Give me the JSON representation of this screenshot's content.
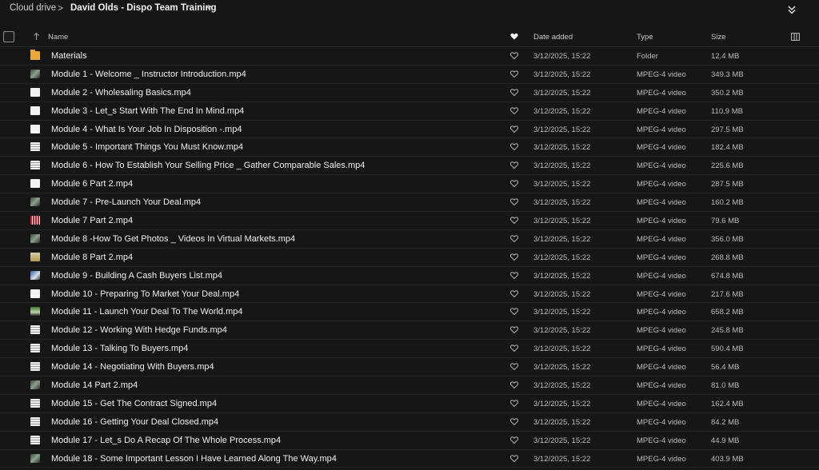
{
  "breadcrumb": {
    "root": "Cloud drive",
    "separator": ">",
    "current": "David Olds - Dispo Team Training"
  },
  "icons": {
    "chevron": "chevron-down-icon",
    "collapse": "double-chevron-down-icon",
    "sort": "sort-arrow-up-icon",
    "favorite_header": "heart-filled-icon",
    "favorite_row": "heart-outline-icon",
    "columns": "columns-icon"
  },
  "columns": {
    "name": "Name",
    "date_added": "Date added",
    "type": "Type",
    "size": "Size"
  },
  "colors": {
    "background": "#161616",
    "folder": "#e9a93a",
    "text": "#efefef",
    "muted": "#bcbcbc"
  },
  "rows": [
    {
      "thumb": "folder",
      "name": "Materials",
      "date": "3/12/2025, 15:22",
      "type": "Folder",
      "size": "12.4 MB"
    },
    {
      "thumb": "dark",
      "name": "Module 1 - Welcome _ Instructor Introduction.mp4",
      "date": "3/12/2025, 15:22",
      "type": "MPEG-4 video",
      "size": "349.3 MB"
    },
    {
      "thumb": "white",
      "name": "Module 2 - Wholesaling Basics.mp4",
      "date": "3/12/2025, 15:22",
      "type": "MPEG-4 video",
      "size": "350.2 MB"
    },
    {
      "thumb": "white",
      "name": "Module 3 - Let_s Start With The End In Mind.mp4",
      "date": "3/12/2025, 15:22",
      "type": "MPEG-4 video",
      "size": "110.9 MB"
    },
    {
      "thumb": "white",
      "name": "Module 4 - What Is Your Job In Disposition -.mp4",
      "date": "3/12/2025, 15:22",
      "type": "MPEG-4 video",
      "size": "297.5 MB"
    },
    {
      "thumb": "doc",
      "name": "Module 5 - Important Things You Must Know.mp4",
      "date": "3/12/2025, 15:22",
      "type": "MPEG-4 video",
      "size": "182.4 MB"
    },
    {
      "thumb": "doc",
      "name": "Module 6 - How To Establish Your Selling Price _ Gather Comparable Sales.mp4",
      "date": "3/12/2025, 15:22",
      "type": "MPEG-4 video",
      "size": "225.6 MB"
    },
    {
      "thumb": "white",
      "name": "Module 6 Part 2.mp4",
      "date": "3/12/2025, 15:22",
      "type": "MPEG-4 video",
      "size": "287.5 MB"
    },
    {
      "thumb": "dark",
      "name": "Module 7 - Pre-Launch Your Deal.mp4",
      "date": "3/12/2025, 15:22",
      "type": "MPEG-4 video",
      "size": "160.2 MB"
    },
    {
      "thumb": "red",
      "name": "Module 7 Part 2.mp4",
      "date": "3/12/2025, 15:22",
      "type": "MPEG-4 video",
      "size": "79.6 MB"
    },
    {
      "thumb": "dark",
      "name": "Module 8 -How To Get Photos _ Videos In Virtual Markets.mp4",
      "date": "3/12/2025, 15:22",
      "type": "MPEG-4 video",
      "size": "356.0 MB"
    },
    {
      "thumb": "paper",
      "name": "Module 8 Part 2.mp4",
      "date": "3/12/2025, 15:22",
      "type": "MPEG-4 video",
      "size": "268.8 MB"
    },
    {
      "thumb": "blue",
      "name": "Module 9 - Building A Cash Buyers List.mp4",
      "date": "3/12/2025, 15:22",
      "type": "MPEG-4 video",
      "size": "674.8 MB"
    },
    {
      "thumb": "white",
      "name": "Module 10 - Preparing To Market Your Deal.mp4",
      "date": "3/12/2025, 15:22",
      "type": "MPEG-4 video",
      "size": "217.6 MB"
    },
    {
      "thumb": "green",
      "name": "Module 11 - Launch Your Deal To The World.mp4",
      "date": "3/12/2025, 15:22",
      "type": "MPEG-4 video",
      "size": "658.2 MB"
    },
    {
      "thumb": "doc",
      "name": "Module 12 - Working With Hedge Funds.mp4",
      "date": "3/12/2025, 15:22",
      "type": "MPEG-4 video",
      "size": "245.8 MB"
    },
    {
      "thumb": "doc",
      "name": "Module 13 - Talking To Buyers.mp4",
      "date": "3/12/2025, 15:22",
      "type": "MPEG-4 video",
      "size": "590.4 MB"
    },
    {
      "thumb": "doc",
      "name": "Module 14 - Negotiating With Buyers.mp4",
      "date": "3/12/2025, 15:22",
      "type": "MPEG-4 video",
      "size": "56.4 MB"
    },
    {
      "thumb": "dark",
      "name": "Module 14 Part 2.mp4",
      "date": "3/12/2025, 15:22",
      "type": "MPEG-4 video",
      "size": "81.0 MB"
    },
    {
      "thumb": "doc",
      "name": "Module 15 - Get The Contract Signed.mp4",
      "date": "3/12/2025, 15:22",
      "type": "MPEG-4 video",
      "size": "162.4 MB"
    },
    {
      "thumb": "doc",
      "name": "Module 16 - Getting Your Deal Closed.mp4",
      "date": "3/12/2025, 15:22",
      "type": "MPEG-4 video",
      "size": "84.2 MB"
    },
    {
      "thumb": "doc",
      "name": "Module 17 - Let_s Do A Recap Of The Whole Process.mp4",
      "date": "3/12/2025, 15:22",
      "type": "MPEG-4 video",
      "size": "44.9 MB"
    },
    {
      "thumb": "dark",
      "name": "Module 18 - Some Important Lesson I Have Learned Along The Way.mp4",
      "date": "3/12/2025, 15:22",
      "type": "MPEG-4 video",
      "size": "403.9 MB"
    }
  ]
}
